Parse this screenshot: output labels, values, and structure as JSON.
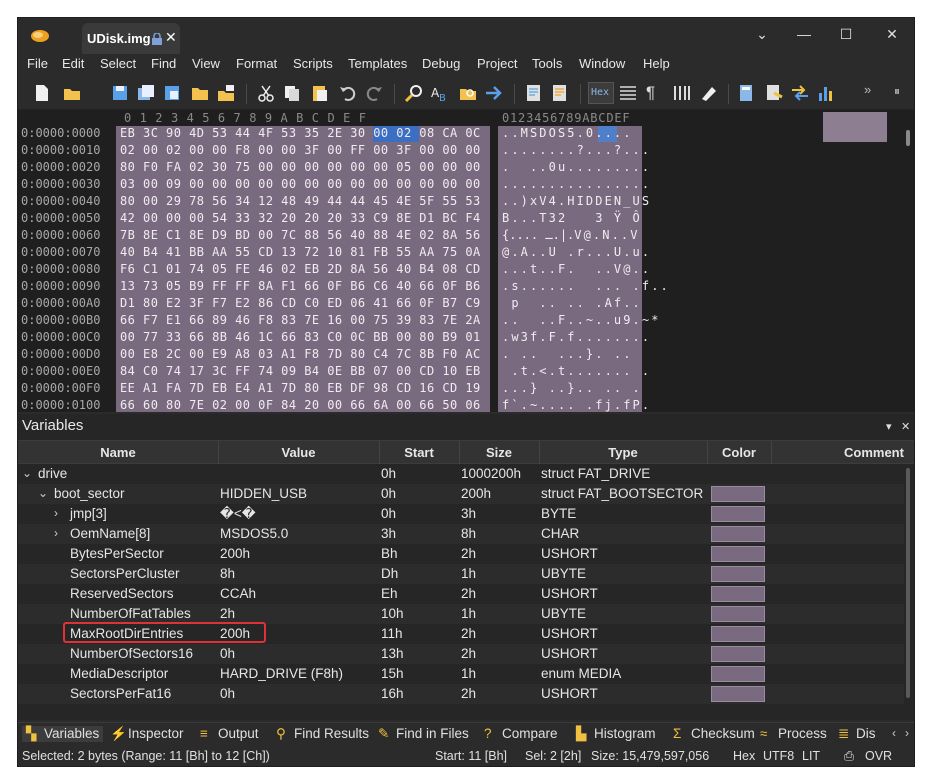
{
  "window": {
    "tab_title": "UDisk.img",
    "controls": {
      "menu": "⌄",
      "minimize": "—",
      "maximize": "☐",
      "close": "✕"
    }
  },
  "menu": [
    "File",
    "Edit",
    "Select",
    "Find",
    "View",
    "Format",
    "Scripts",
    "Templates",
    "Debug",
    "Project",
    "Tools",
    "Window",
    "Help"
  ],
  "toolbar": {
    "hex_label": "Hex",
    "icons": [
      "new-file-icon",
      "open-folder-icon",
      "save-icon",
      "save-all-icon",
      "save-as-icon",
      "open-folder2-icon",
      "open-workspace-icon",
      "cut-icon",
      "copy-icon",
      "paste-icon",
      "undo-icon",
      "redo-icon",
      "find-icon",
      "find-replace-icon",
      "find-in-files-icon",
      "goto-icon",
      "run-script-icon",
      "run-template-icon",
      "hex-mode-icon",
      "binary-mode-icon",
      "paragraph-icon",
      "columns-icon",
      "highlight-icon",
      "calculator-icon",
      "inspector-icon",
      "compare-icon",
      "histogram-icon"
    ]
  },
  "hex": {
    "column_header": "0  1  2  3  4  5  6  7  8  9  A  B  C  D  E  F",
    "ascii_header": "0123456789ABCDEF",
    "rows": [
      {
        "addr": "0:0000:0000",
        "hex": "EB 3C 90 4D 53 44 4F 53 35 2E 30 00 02 08 CA 0C",
        "ascii": "..MSDOS5.0.... "
      },
      {
        "addr": "0:0000:0010",
        "hex": "02 00 02 00 00 F8 00 00 3F 00 FF 00 3F 00 00 00",
        "ascii": "........?...?..."
      },
      {
        "addr": "0:0000:0020",
        "hex": "80 F0 FA 02 30 75 00 00 00 00 00 00 05 00 00 00",
        "ascii": ".  ..0u........."
      },
      {
        "addr": "0:0000:0030",
        "hex": "03 00 09 00 00 00 00 00 00 00 00 00 00 00 00 00",
        "ascii": "................"
      },
      {
        "addr": "0:0000:0040",
        "hex": "80 00 29 78 56 34 12 48 49 44 44 45 4E 5F 55 53",
        "ascii": "..)xV4.HIDDEN_US"
      },
      {
        "addr": "0:0000:0050",
        "hex": "42 00 00 00 54 33 32 20 20 20 33 C9 8E D1 BC F4",
        "ascii": "B...T32   3 Ÿ Ô "
      },
      {
        "addr": "0:0000:0060",
        "hex": "7B 8E C1 8E D9 BD 00 7C 88 56 40 88 4E 02 8A 56",
        "ascii": "{.... ـ.|.V@.N..V"
      },
      {
        "addr": "0:0000:0070",
        "hex": "40 B4 41 BB AA 55 CD 13 72 10 81 FB 55 AA 75 0A",
        "ascii": "@.A..U .r...U.u."
      },
      {
        "addr": "0:0000:0080",
        "hex": "F6 C1 01 74 05 FE 46 02 EB 2D 8A 56 40 B4 08 CD",
        "ascii": "...t..F.  ..V@.. "
      },
      {
        "addr": "0:0000:0090",
        "hex": "13 73 05 B9 FF FF 8A F1 66 0F B6 C6 40 66 0F B6",
        "ascii": ".s......  ... .f.."
      },
      {
        "addr": "0:0000:00A0",
        "hex": "D1 80 E2 3F F7 E2 86 CD C0 ED 06 41 66 0F B7 C9",
        "ascii": " p  .. .. .Af.. "
      },
      {
        "addr": "0:0000:00B0",
        "hex": "66 F7 E1 66 89 46 F8 83 7E 16 00 75 39 83 7E 2A",
        "ascii": "..  ..F..~..u9.~*"
      },
      {
        "addr": "0:0000:00C0",
        "hex": "00 77 33 66 8B 46 1C 66 83 C0 0C BB 00 80 B9 01",
        "ascii": ".w3f.F.f........"
      },
      {
        "addr": "0:0000:00D0",
        "hex": "00 E8 2C 00 E9 A8 03 A1 F8 7D 80 C4 7C 8B F0 AC",
        "ascii": ". ..  ...}. ..  "
      },
      {
        "addr": "0:0000:00E0",
        "hex": "84 C0 74 17 3C FF 74 09 B4 0E BB 07 00 CD 10 EB",
        "ascii": " .t.<.t....... . "
      },
      {
        "addr": "0:0000:00F0",
        "hex": "EE A1 FA 7D EB E4 A1 7D 80 EB DF 98 CD 16 CD 19",
        "ascii": "...} ..}.. .. . "
      },
      {
        "addr": "0:0000:0100",
        "hex": "66 60 80 7E 02 00 0F 84 20 00 66 6A 00 66 50 06",
        "ascii": "f`.~.... .fj.fP."
      }
    ]
  },
  "variables": {
    "title": "Variables",
    "pin": "▾",
    "close": "✕",
    "columns": [
      "Name",
      "Value",
      "Start",
      "Size",
      "Type",
      "Color",
      "Comment"
    ],
    "rows": [
      {
        "name": "drive",
        "value": "",
        "start": "0h",
        "size": "1000200h",
        "type": "struct FAT_DRIVE",
        "indent": 0,
        "chev": "⌄",
        "swatch": false
      },
      {
        "name": "boot_sector",
        "value": "HIDDEN_USB",
        "start": "0h",
        "size": "200h",
        "type": "struct FAT_BOOTSECTOR",
        "indent": 1,
        "chev": "⌄",
        "swatch": true
      },
      {
        "name": "jmp[3]",
        "value": "�<�",
        "start": "0h",
        "size": "3h",
        "type": "BYTE",
        "indent": 2,
        "chev": "›",
        "swatch": true
      },
      {
        "name": "OemName[8]",
        "value": "MSDOS5.0",
        "start": "3h",
        "size": "8h",
        "type": "CHAR",
        "indent": 2,
        "chev": "›",
        "swatch": true
      },
      {
        "name": "BytesPerSector",
        "value": "200h",
        "start": "Bh",
        "size": "2h",
        "type": "USHORT",
        "indent": 2,
        "chev": "",
        "swatch": true
      },
      {
        "name": "SectorsPerCluster",
        "value": "8h",
        "start": "Dh",
        "size": "1h",
        "type": "UBYTE",
        "indent": 2,
        "chev": "",
        "swatch": true
      },
      {
        "name": "ReservedSectors",
        "value": "CCAh",
        "start": "Eh",
        "size": "2h",
        "type": "USHORT",
        "indent": 2,
        "chev": "",
        "swatch": true
      },
      {
        "name": "NumberOfFatTables",
        "value": "2h",
        "start": "10h",
        "size": "1h",
        "type": "UBYTE",
        "indent": 2,
        "chev": "",
        "swatch": true
      },
      {
        "name": "MaxRootDirEntries",
        "value": "200h",
        "start": "11h",
        "size": "2h",
        "type": "USHORT",
        "indent": 2,
        "chev": "",
        "swatch": true
      },
      {
        "name": "NumberOfSectors16",
        "value": "0h",
        "start": "13h",
        "size": "2h",
        "type": "USHORT",
        "indent": 2,
        "chev": "",
        "swatch": true
      },
      {
        "name": "MediaDescriptor",
        "value": "HARD_DRIVE (F8h)",
        "start": "15h",
        "size": "1h",
        "type": "enum MEDIA",
        "indent": 2,
        "chev": "",
        "swatch": true
      },
      {
        "name": "SectorsPerFat16",
        "value": "0h",
        "start": "16h",
        "size": "2h",
        "type": "USHORT",
        "indent": 2,
        "chev": "",
        "swatch": true
      }
    ]
  },
  "bottom_tabs": [
    {
      "label": "Variables",
      "icon": "variables-icon",
      "glyph": "▚"
    },
    {
      "label": "Inspector",
      "icon": "inspector-icon",
      "glyph": "⚡"
    },
    {
      "label": "Output",
      "icon": "output-icon",
      "glyph": "≡"
    },
    {
      "label": "Find Results",
      "icon": "find-results-icon",
      "glyph": "⚲"
    },
    {
      "label": "Find in Files",
      "icon": "find-in-files-icon",
      "glyph": "✎"
    },
    {
      "label": "Compare",
      "icon": "compare-icon",
      "glyph": "?"
    },
    {
      "label": "Histogram",
      "icon": "histogram-icon",
      "glyph": "▙"
    },
    {
      "label": "Checksum",
      "icon": "checksum-icon",
      "glyph": "Σ"
    },
    {
      "label": "Process",
      "icon": "process-icon",
      "glyph": "≈"
    },
    {
      "label": "Dis",
      "icon": "disassembler-icon",
      "glyph": "≣"
    }
  ],
  "status": {
    "selected": "Selected: 2 bytes (Range: 11 [Bh] to 12 [Ch])",
    "start": "Start: 11 [Bh]",
    "sel": "Sel: 2 [2h]",
    "size": "Size: 15,479,597,056",
    "mode": "Hex",
    "encoding": "UTF8",
    "endian": "LIT",
    "insert": "OVR"
  },
  "colors": {
    "selection_blue": "#3a6fc4",
    "template_purple": "#7a6a80",
    "highlight_red": "#e0303a",
    "background": "#2b2b2b"
  }
}
